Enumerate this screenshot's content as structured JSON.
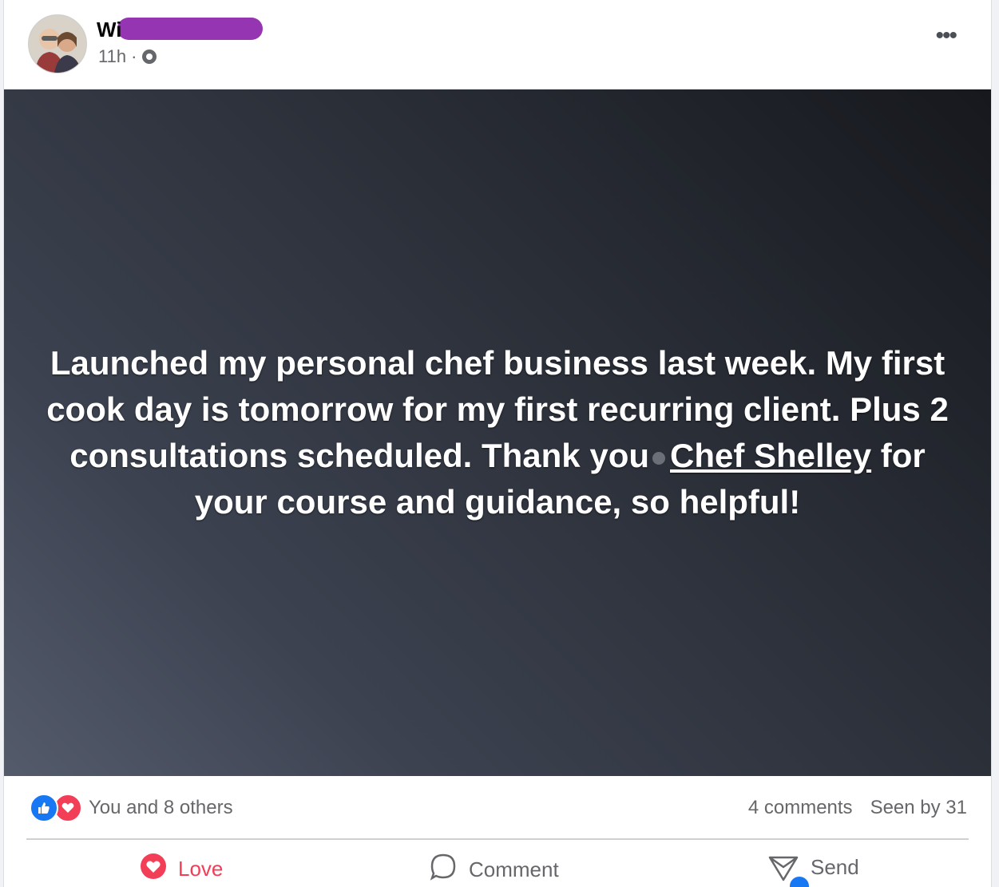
{
  "post": {
    "author_name_prefix": "Wi",
    "timestamp": "11h",
    "separator": "·",
    "text_before_mention": "Launched my personal chef business last week. My first cook day is tomorrow for my first recurring client. Plus 2 consultations scheduled. Thank you",
    "mention": "Chef Shelley",
    "text_after_mention": " for your course and guidance, so helpful!"
  },
  "stats": {
    "reactors": "You and 8 others",
    "comments": "4 comments",
    "seen": "Seen by 31"
  },
  "actions": {
    "love_label": "Love",
    "comment_label": "Comment",
    "send_label": "Send"
  },
  "colors": {
    "love": "#f33e58",
    "like": "#1877f2",
    "redaction": "#8b1fa8"
  },
  "icons": [
    "avatar",
    "globe-icon",
    "more-icon",
    "like-reaction-icon",
    "love-reaction-icon",
    "heart-icon",
    "comment-icon",
    "send-icon"
  ]
}
